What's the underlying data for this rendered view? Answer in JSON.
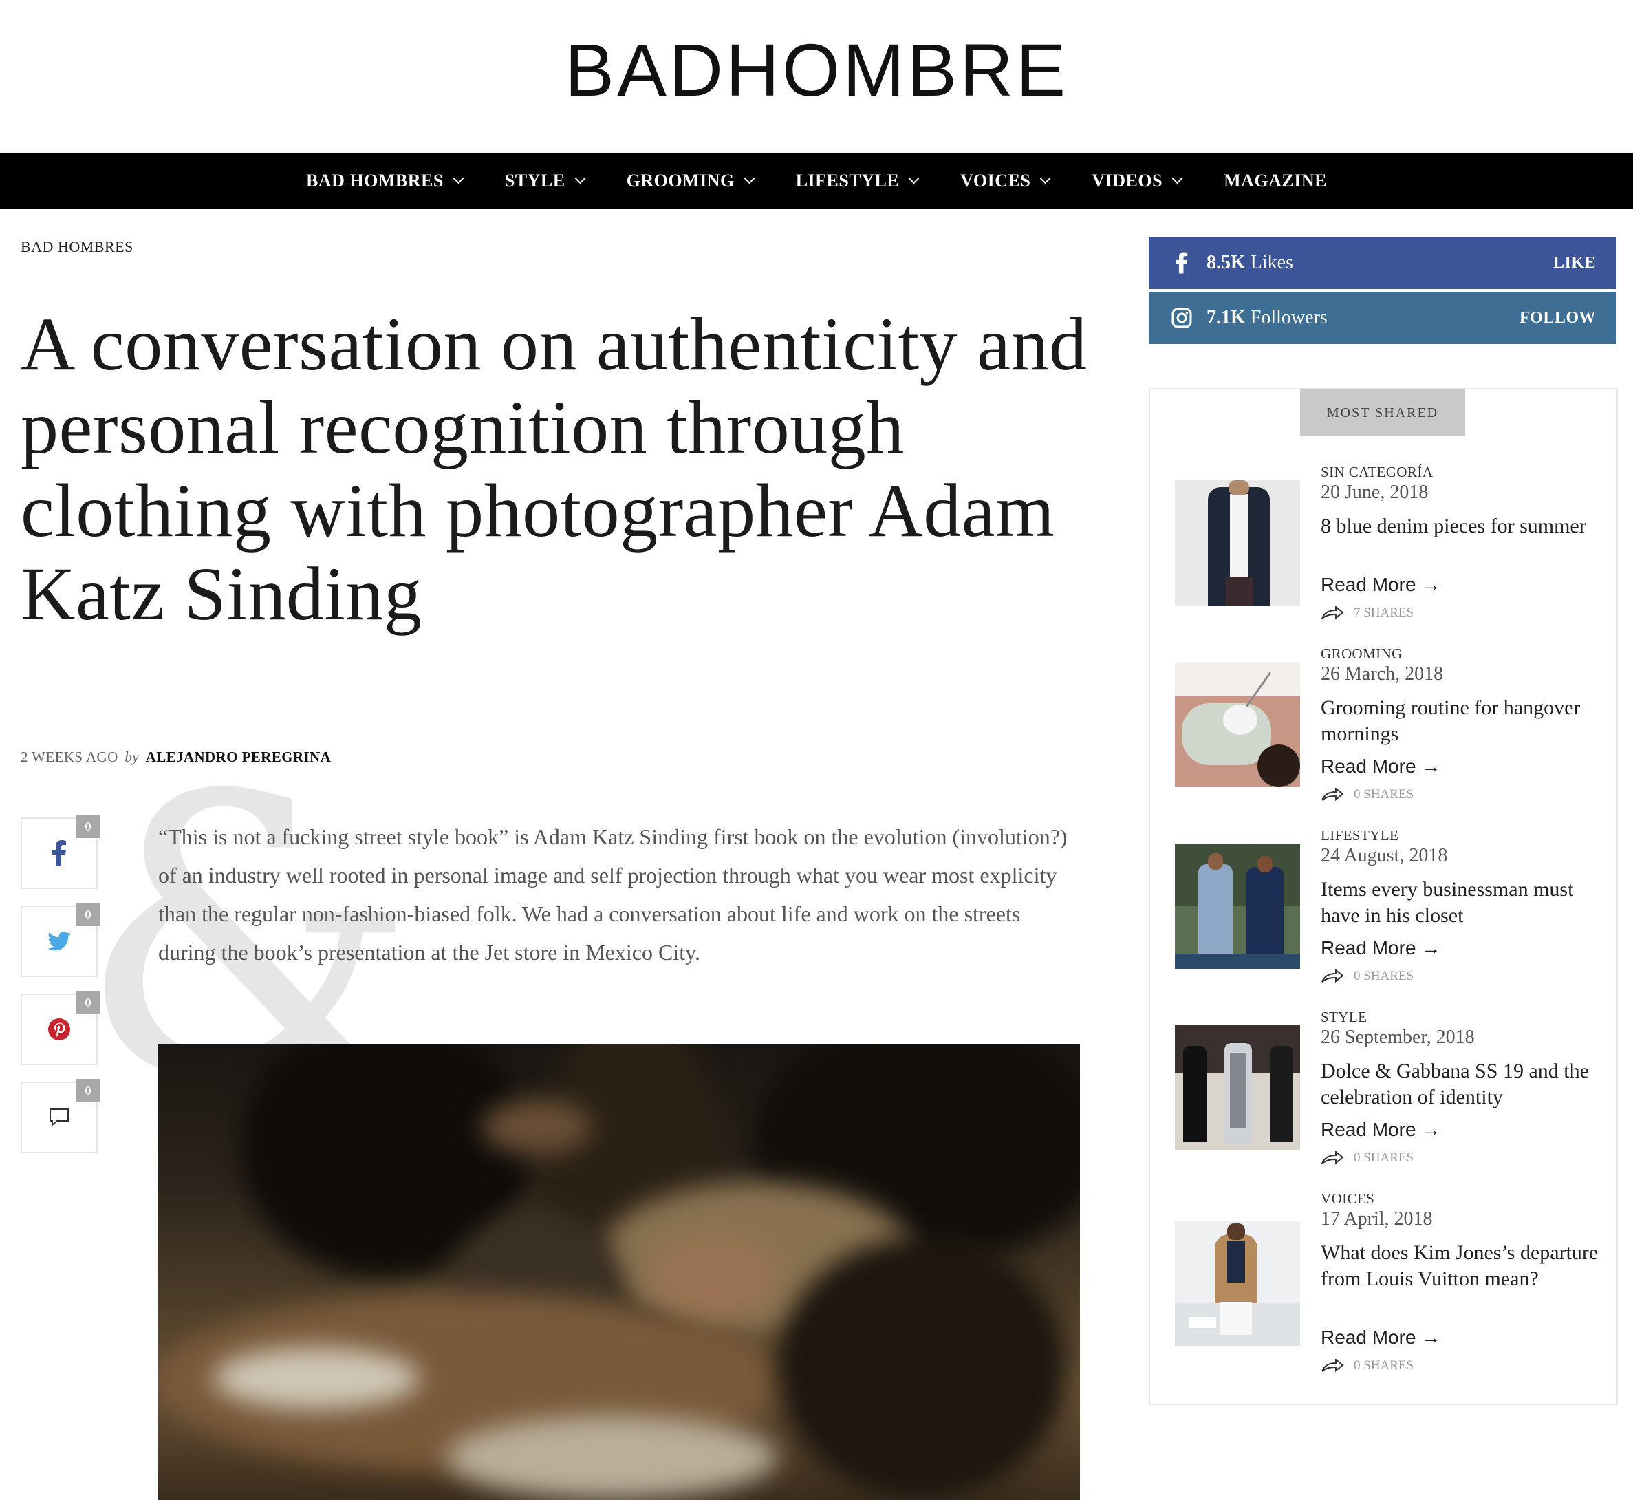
{
  "site": {
    "logo": "BADHOMBRE"
  },
  "nav": {
    "items": [
      {
        "label": "BAD HOMBRES",
        "has_dropdown": true
      },
      {
        "label": "STYLE",
        "has_dropdown": true
      },
      {
        "label": "GROOMING",
        "has_dropdown": true
      },
      {
        "label": "LIFESTYLE",
        "has_dropdown": true
      },
      {
        "label": "VOICES",
        "has_dropdown": true
      },
      {
        "label": "VIDEOS",
        "has_dropdown": true
      },
      {
        "label": "MAGAZINE",
        "has_dropdown": false
      }
    ]
  },
  "article": {
    "category": "BAD HOMBRES",
    "title": "A conversation on authenticity and personal recognition through clothing with photographer Adam Katz Sinding",
    "time_ago": "2 WEEKS AGO",
    "by": "by",
    "author": "ALEJANDRO PEREGRINA",
    "intro": "“This is not a fucking street style book” is Adam Katz Sinding first book on the evolution (involution?) of an industry well rooted in personal image and self projection through what you wear most explicity than the regular non-fashion-biased folk. We had a conversation about life and work on the streets during the book’s presentation at the Jet store in Mexico City.",
    "share_buttons": [
      {
        "icon": "facebook-icon",
        "count": "0",
        "color": "#3b5598"
      },
      {
        "icon": "twitter-icon",
        "count": "0",
        "color": "#4aa8e8"
      },
      {
        "icon": "pinterest-icon",
        "count": "0",
        "color": "#c8232c"
      },
      {
        "icon": "comment-icon",
        "count": "0",
        "color": "#333333"
      }
    ]
  },
  "sidebar": {
    "facebook": {
      "count": "8.5K",
      "unit": "Likes",
      "action": "LIKE",
      "color": "#3b5598"
    },
    "instagram": {
      "count": "7.1K",
      "unit": "Followers",
      "action": "FOLLOW",
      "color": "#3f6e95"
    },
    "most_shared_label": "MOST SHARED",
    "read_more": "Read More →",
    "posts": [
      {
        "category": "SIN CATEGORÍA",
        "date": "20 June, 2018",
        "title": "8 blue denim pieces for summer",
        "shares": "7 SHARES"
      },
      {
        "category": "GROOMING",
        "date": "26 March, 2018",
        "title": "Grooming routine for hangover mornings",
        "shares": "0 SHARES"
      },
      {
        "category": "LIFESTYLE",
        "date": "24 August, 2018",
        "title": "Items every businessman must have in his closet",
        "shares": "0 SHARES"
      },
      {
        "category": "STYLE",
        "date": "26 September, 2018",
        "title": "Dolce & Gabbana SS 19 and the celebration of identity",
        "shares": "0 SHARES"
      },
      {
        "category": "VOICES",
        "date": "17 April, 2018",
        "title": "What does Kim Jones’s departure from Louis Vuitton mean?",
        "shares": "0 SHARES"
      }
    ]
  }
}
